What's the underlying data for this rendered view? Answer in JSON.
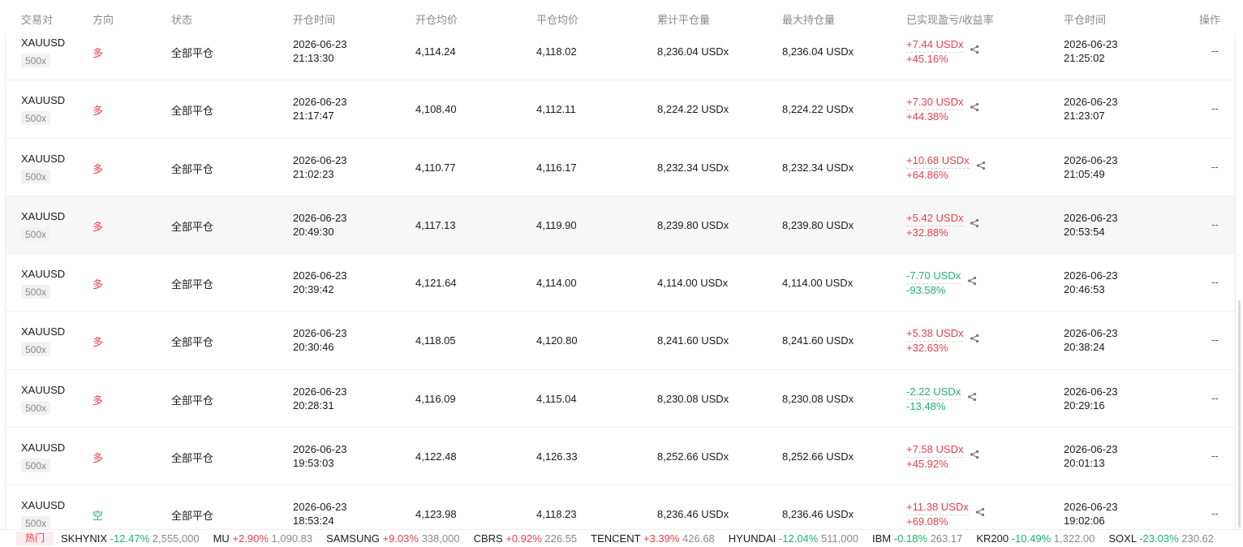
{
  "header": {
    "pair": "交易对",
    "direction": "方向",
    "status": "状态",
    "open_time": "开仓时间",
    "open_avg": "开仓均价",
    "close_avg": "平仓均价",
    "cum_close": "累计平仓量",
    "max_hold": "最大持仓量",
    "pnl": "已实现盈亏/收益率",
    "close_time": "平仓时间",
    "action": "操作"
  },
  "rows": [
    {
      "symbol": "XAUUSD",
      "lev": "500x",
      "dir": "多",
      "dir_type": "long",
      "status": "全部平仓",
      "open_date": "2026-06-23",
      "open_time": "21:13:30",
      "open_avg": "4,114.24",
      "close_avg": "4,118.02",
      "cum": "8,236.04 USDx",
      "max": "8,236.04 USDx",
      "pnl": "+7.44 USDx",
      "roi": "+45.16%",
      "pnl_type": "pos",
      "close_date": "2026-06-23",
      "close_time": "21:25:02",
      "op": "--"
    },
    {
      "symbol": "XAUUSD",
      "lev": "500x",
      "dir": "多",
      "dir_type": "long",
      "status": "全部平仓",
      "open_date": "2026-06-23",
      "open_time": "21:17:47",
      "open_avg": "4,108.40",
      "close_avg": "4,112.11",
      "cum": "8,224.22 USDx",
      "max": "8,224.22 USDx",
      "pnl": "+7.30 USDx",
      "roi": "+44.38%",
      "pnl_type": "pos",
      "close_date": "2026-06-23",
      "close_time": "21:23:07",
      "op": "--"
    },
    {
      "symbol": "XAUUSD",
      "lev": "500x",
      "dir": "多",
      "dir_type": "long",
      "status": "全部平仓",
      "open_date": "2026-06-23",
      "open_time": "21:02:23",
      "open_avg": "4,110.77",
      "close_avg": "4,116.17",
      "cum": "8,232.34 USDx",
      "max": "8,232.34 USDx",
      "pnl": "+10.68 USDx",
      "roi": "+64.86%",
      "pnl_type": "pos",
      "close_date": "2026-06-23",
      "close_time": "21:05:49",
      "op": "--"
    },
    {
      "symbol": "XAUUSD",
      "lev": "500x",
      "dir": "多",
      "dir_type": "long",
      "status": "全部平仓",
      "open_date": "2026-06-23",
      "open_time": "20:49:30",
      "open_avg": "4,117.13",
      "close_avg": "4,119.90",
      "cum": "8,239.80 USDx",
      "max": "8,239.80 USDx",
      "pnl": "+5.42 USDx",
      "roi": "+32.88%",
      "pnl_type": "pos",
      "close_date": "2026-06-23",
      "close_time": "20:53:54",
      "op": "--"
    },
    {
      "symbol": "XAUUSD",
      "lev": "500x",
      "dir": "多",
      "dir_type": "long",
      "status": "全部平仓",
      "open_date": "2026-06-23",
      "open_time": "20:39:42",
      "open_avg": "4,121.64",
      "close_avg": "4,114.00",
      "cum": "4,114.00 USDx",
      "max": "4,114.00 USDx",
      "pnl": "-7.70 USDx",
      "roi": "-93.58%",
      "pnl_type": "neg",
      "close_date": "2026-06-23",
      "close_time": "20:46:53",
      "op": "--"
    },
    {
      "symbol": "XAUUSD",
      "lev": "500x",
      "dir": "多",
      "dir_type": "long",
      "status": "全部平仓",
      "open_date": "2026-06-23",
      "open_time": "20:30:46",
      "open_avg": "4,118.05",
      "close_avg": "4,120.80",
      "cum": "8,241.60 USDx",
      "max": "8,241.60 USDx",
      "pnl": "+5.38 USDx",
      "roi": "+32.63%",
      "pnl_type": "pos",
      "close_date": "2026-06-23",
      "close_time": "20:38:24",
      "op": "--"
    },
    {
      "symbol": "XAUUSD",
      "lev": "500x",
      "dir": "多",
      "dir_type": "long",
      "status": "全部平仓",
      "open_date": "2026-06-23",
      "open_time": "20:28:31",
      "open_avg": "4,116.09",
      "close_avg": "4,115.04",
      "cum": "8,230.08 USDx",
      "max": "8,230.08 USDx",
      "pnl": "-2.22 USDx",
      "roi": "-13.48%",
      "pnl_type": "neg",
      "close_date": "2026-06-23",
      "close_time": "20:29:16",
      "op": "--"
    },
    {
      "symbol": "XAUUSD",
      "lev": "500x",
      "dir": "多",
      "dir_type": "long",
      "status": "全部平仓",
      "open_date": "2026-06-23",
      "open_time": "19:53:03",
      "open_avg": "4,122.48",
      "close_avg": "4,126.33",
      "cum": "8,252.66 USDx",
      "max": "8,252.66 USDx",
      "pnl": "+7.58 USDx",
      "roi": "+45.92%",
      "pnl_type": "pos",
      "close_date": "2026-06-23",
      "close_time": "20:01:13",
      "op": "--"
    },
    {
      "symbol": "XAUUSD",
      "lev": "500x",
      "dir": "空",
      "dir_type": "short",
      "status": "全部平仓",
      "open_date": "2026-06-23",
      "open_time": "18:53:24",
      "open_avg": "4,123.98",
      "close_avg": "4,118.23",
      "cum": "8,236.46 USDx",
      "max": "8,236.46 USDx",
      "pnl": "+11.38 USDx",
      "roi": "+69.08%",
      "pnl_type": "pos",
      "close_date": "2026-06-23",
      "close_time": "19:02:06",
      "op": "--"
    }
  ],
  "ticker": {
    "hot_label": "热门",
    "items": [
      {
        "name": "SKHYNIX",
        "change": "-12.47%",
        "type": "neg",
        "price": "2,555,000"
      },
      {
        "name": "MU",
        "change": "+2.90%",
        "type": "pos",
        "price": "1,090.83"
      },
      {
        "name": "SAMSUNG",
        "change": "+9.03%",
        "type": "pos",
        "price": "338,000"
      },
      {
        "name": "CBRS",
        "change": "+0.92%",
        "type": "pos",
        "price": "226.55"
      },
      {
        "name": "TENCENT",
        "change": "+3.39%",
        "type": "pos",
        "price": "426.68"
      },
      {
        "name": "HYUNDAI",
        "change": "-12.04%",
        "type": "neg",
        "price": "511,000"
      },
      {
        "name": "IBM",
        "change": "-0.18%",
        "type": "neg",
        "price": "263.17"
      },
      {
        "name": "KR200",
        "change": "-10.49%",
        "type": "neg",
        "price": "1,322.00"
      },
      {
        "name": "SOXL",
        "change": "-23.03%",
        "type": "neg",
        "price": "230.62"
      }
    ]
  },
  "colors": {
    "up": "#e8404a",
    "down": "#20b26c",
    "muted": "#8a8a8a"
  },
  "icons": {
    "share": "share-icon"
  }
}
